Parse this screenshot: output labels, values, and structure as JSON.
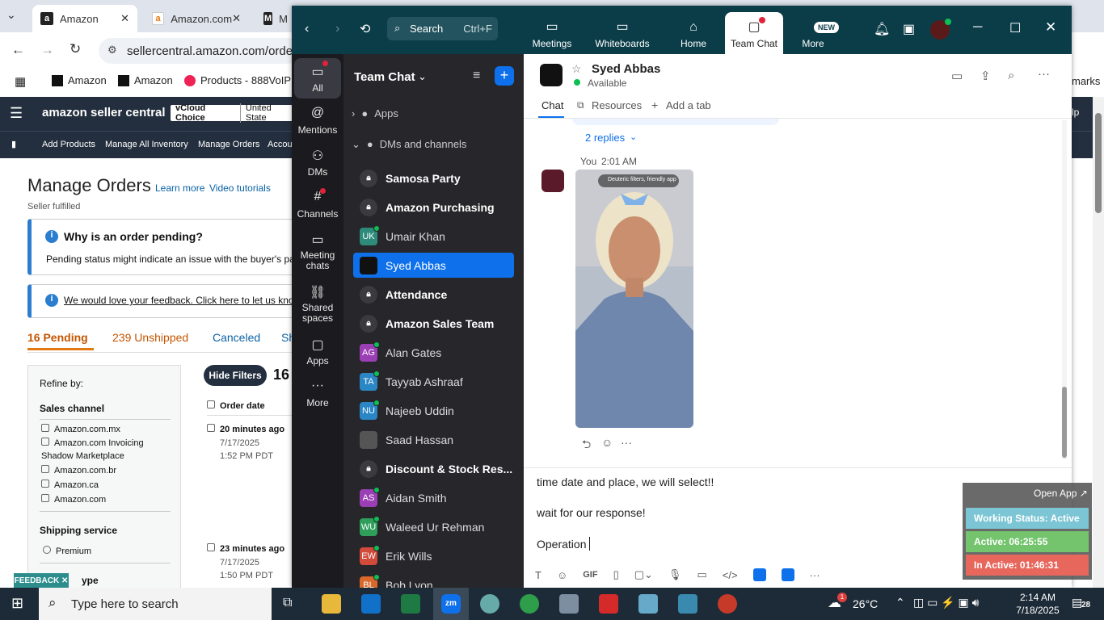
{
  "browser": {
    "tabs": [
      {
        "label": "Amazon"
      },
      {
        "label": "Amazon.com"
      },
      {
        "label": "M"
      }
    ],
    "url": "sellercentral.amazon.com/orders-",
    "bookmarks": [
      "Amazon",
      "Amazon",
      "Products - 888VoIP"
    ],
    "bookmarks_suffix": "marks"
  },
  "amazon": {
    "logo": "amazon seller central",
    "account": "vCloud Choice",
    "region": "United State",
    "nav": [
      "Add Products",
      "Manage All Inventory",
      "Manage Orders",
      "Accou"
    ],
    "page_title": "Manage Orders",
    "learn_more": "Learn more",
    "video": "Video tutorials",
    "subtitle": "Seller fulfilled",
    "pending_title": "Why is an order pending?",
    "pending_text": "Pending status might indicate an issue with the buyer's payr",
    "feedback_link": "We would love your feedback. Click here to let us know",
    "tabs": [
      "16 Pending",
      "239 Unshipped",
      "Canceled",
      "Sh"
    ],
    "refine": "Refine by:",
    "sales_channel": "Sales channel",
    "channels": [
      "Amazon.com.mx",
      "Amazon.com Invoicing",
      "Shadow Marketplace",
      "Amazon.com.br",
      "Amazon.ca",
      "Amazon.com"
    ],
    "shipping": "Shipping service",
    "premium": "Premium",
    "hide_filters": "Hide Filters",
    "count": "16",
    "order_date": "Order date",
    "orders": [
      {
        "ago": "20 minutes ago",
        "date": "7/17/2025",
        "time": "1:52 PM PDT"
      },
      {
        "ago": "23 minutes ago",
        "date": "7/17/2025",
        "time": "1:50 PM PDT"
      }
    ],
    "feedback_btn": "FEEDBACK ✕",
    "type_label": "ype"
  },
  "zoom": {
    "search": "Search",
    "shortcut": "Ctrl+F",
    "top_nav": [
      "Meetings",
      "Whiteboards",
      "Home",
      "Team Chat",
      "More"
    ],
    "new_badge": "NEW",
    "left_nav": [
      "All",
      "Mentions",
      "DMs",
      "Channels",
      "Meeting chats",
      "Shared spaces",
      "Apps",
      "More"
    ],
    "list_title": "Team Chat",
    "apps_label": "Apps",
    "dms_label": "DMs and channels",
    "channels": [
      {
        "name": "Samosa Party",
        "init": "",
        "color": "#3a3a40",
        "bold": true
      },
      {
        "name": "Amazon Purchasing",
        "init": "",
        "color": "#3a3a40",
        "bold": true
      },
      {
        "name": "Umair Khan",
        "init": "UK",
        "color": "#2e8b7a",
        "bold": false
      },
      {
        "name": "Syed Abbas",
        "init": "",
        "color": "#111",
        "bold": false
      },
      {
        "name": "Attendance",
        "init": "",
        "color": "#3a3a40",
        "bold": true
      },
      {
        "name": "Amazon Sales Team",
        "init": "",
        "color": "#3a3a40",
        "bold": true
      },
      {
        "name": "Alan Gates",
        "init": "AG",
        "color": "#9b3fb5",
        "bold": false
      },
      {
        "name": "Tayyab Ashraaf",
        "init": "TA",
        "color": "#2b86c5",
        "bold": false
      },
      {
        "name": "Najeeb Uddin",
        "init": "NU",
        "color": "#2b86c5",
        "bold": false
      },
      {
        "name": "Saad Hassan",
        "init": "",
        "color": "#555",
        "bold": false
      },
      {
        "name": "Discount & Stock Res...",
        "init": "",
        "color": "#3a3a40",
        "bold": true
      },
      {
        "name": "Aidan Smith",
        "init": "AS",
        "color": "#9b3fb5",
        "bold": false
      },
      {
        "name": "Waleed Ur Rehman",
        "init": "WU",
        "color": "#2e9e5a",
        "bold": false
      },
      {
        "name": "Erik Wills",
        "init": "EW",
        "color": "#d14a3a",
        "bold": false
      },
      {
        "name": "Bob Lyon",
        "init": "BL",
        "color": "#d9682a",
        "bold": false
      }
    ],
    "chat": {
      "name": "Syed Abbas",
      "status": "Available",
      "tabs": [
        "Chat",
        "Resources",
        "Add a tab"
      ],
      "replies": "2 replies",
      "sender": "You",
      "time": "2:01 AM",
      "image_label": "Deuteric filters, friendly app"
    },
    "compose": [
      "time date and place, we will select!!",
      "wait for our response!",
      "Operation "
    ]
  },
  "widget": {
    "open_app": "Open App ↗",
    "working": "Working Status: Active",
    "active": "Active: 06:25:55",
    "inactive": "In Active: 01:46:31",
    "colors": {
      "working": "#7cc5d4",
      "active": "#73c46c",
      "inactive": "#e8675d"
    }
  },
  "taskbar": {
    "search": "Type here to search",
    "temp": "26°C",
    "time": "2:14 AM",
    "date": "7/18/2025",
    "notif": "28",
    "weather_badge": "1"
  }
}
